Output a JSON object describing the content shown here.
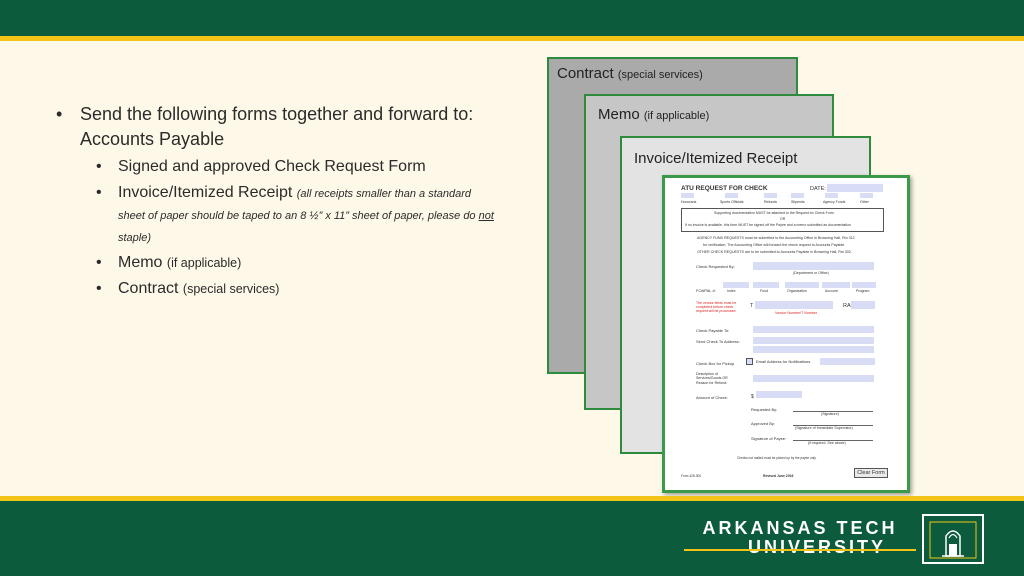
{
  "bullets": {
    "main": "Send the following forms together and forward to:  Accounts Payable",
    "items": [
      {
        "label": "Signed and approved Check Request Form"
      },
      {
        "label": "Invoice/Itemized Receipt",
        "note": "(all receipts smaller than a standard sheet of paper should be taped to an 8 ½” x 11” sheet of paper, please do not staple)",
        "note_pre": "(all receipts smaller than a standard sheet of paper should be taped to an 8 ½” x 11” sheet of paper, please do ",
        "note_u": "not",
        "note_post": " staple)"
      },
      {
        "label": "Memo",
        "paren": "(if applicable)"
      },
      {
        "label": "Contract",
        "paren": "(special services)"
      }
    ]
  },
  "cards": [
    {
      "title": "Contract",
      "paren": "(special services)"
    },
    {
      "title": "Memo",
      "paren": "(if applicable)"
    },
    {
      "title": "Invoice/Itemized Receipt",
      "paren": ""
    }
  ],
  "form": {
    "title": "ATU REQUEST FOR CHECK",
    "date_label": "DATE:",
    "categories": [
      "Honoraria",
      "Sports Officials",
      "Refunds",
      "Stipends",
      "Agency Funds",
      "Other"
    ],
    "notice_1": "Supporting documentation MUST be attached to the Request for Check Form",
    "notice_or": "OR",
    "notice_2": "If no invoice is available, this form MUST be signed off the Payee and a memo submitted as documentation",
    "agency_1": "AGENCY FUND REQUESTS must be submitted to the Accounting Office in Browning Hall, Rm 312",
    "agency_2": "for verification. The Accounting Office will forward the check request to Accounts Payable.",
    "agency_3": "OTHER CHECK REQUESTS are to be submitted to Accounts Payable in Browning Hall, Rm 302.",
    "check_requested_by": "Check Requested By:",
    "dept_office": "(Department or Office)",
    "foapal": "FOAPAL #:",
    "foapal_cols": [
      "Index",
      "Fund",
      "Organization",
      "Account",
      "Program"
    ],
    "red_note": "The vendor fields must be completed before check request will be processed.",
    "t_label": "T",
    "ra_label": "RA",
    "vendor_label": "Vendor Number/T Number",
    "payable_to": "Check Payable To:",
    "send_to": "Send Check To Address:",
    "pickup": "Check Box for Pickup",
    "email": "Email Address for Notifications",
    "description": "Description of Services/Goods OR Reason for Refund:",
    "amount": "Amount of Check:",
    "dollar": "$",
    "requested": "Requested By:",
    "signature": "(Signature)",
    "approved": "Approved By:",
    "supervisor": "(Signature of Immediate Supervisor)",
    "payee_sig": "Signature of Payee:",
    "if_required": "(If required.  See above)",
    "footer_note": "Checks not mailed must be picked up by the payee only.",
    "form_no": "Form 425-300",
    "revised": "Revised June 2016",
    "clear_button": "Clear Form"
  },
  "logo": {
    "line1": "ARKANSAS TECH",
    "line2": "UNIVERSITY"
  },
  "colors": {
    "green": "#0b5b3c",
    "gold": "#f2c418",
    "background": "#fdf8e8"
  }
}
